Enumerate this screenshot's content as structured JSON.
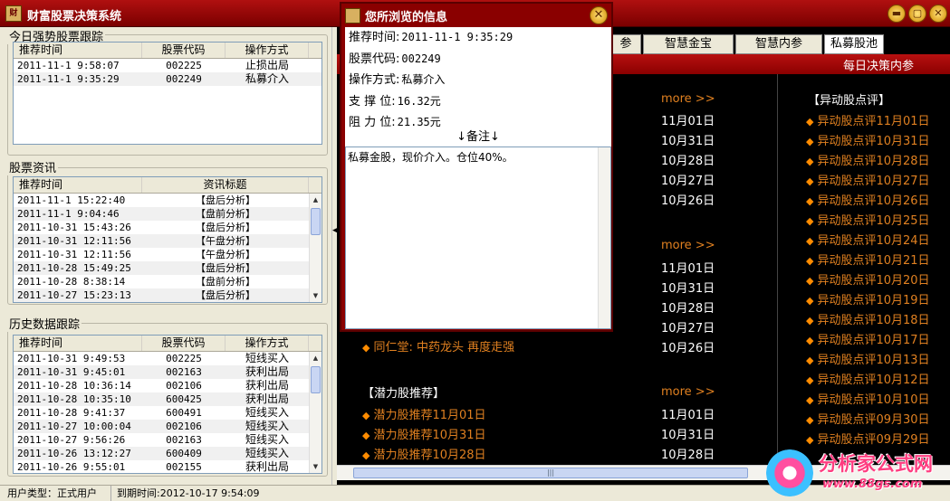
{
  "window": {
    "title": "财富股票决策系统",
    "min": "▬",
    "max": "▢",
    "close": "✕"
  },
  "strong": {
    "label": "今日强势股票跟踪",
    "headers": [
      "推荐时间",
      "股票代码",
      "操作方式"
    ],
    "rows": [
      [
        "2011-11-1 9:58:07",
        "002225",
        "止损出局"
      ],
      [
        "2011-11-1 9:35:29",
        "002249",
        "私募介入"
      ]
    ]
  },
  "news": {
    "label": "股票资讯",
    "headers": [
      "推荐时间",
      "资讯标题"
    ],
    "rows": [
      [
        "2011-11-1 15:22:40",
        "【盘后分析】"
      ],
      [
        "2011-11-1 9:04:46",
        "【盘前分析】"
      ],
      [
        "2011-10-31 15:43:26",
        "【盘后分析】"
      ],
      [
        "2011-10-31 12:11:56",
        "【午盘分析】"
      ],
      [
        "2011-10-31 12:11:56",
        "【午盘分析】"
      ],
      [
        "2011-10-28 15:49:25",
        "【盘后分析】"
      ],
      [
        "2011-10-28 8:38:14",
        "【盘前分析】"
      ],
      [
        "2011-10-27 15:23:13",
        "【盘后分析】"
      ]
    ]
  },
  "history": {
    "label": "历史数据跟踪",
    "headers": [
      "推荐时间",
      "股票代码",
      "操作方式"
    ],
    "rows": [
      [
        "2011-10-31 9:49:53",
        "002225",
        "短线买入"
      ],
      [
        "2011-10-31 9:45:01",
        "002163",
        "获利出局"
      ],
      [
        "2011-10-28 10:36:14",
        "002106",
        "获利出局"
      ],
      [
        "2011-10-28 10:35:10",
        "600425",
        "获利出局"
      ],
      [
        "2011-10-28 9:41:37",
        "600491",
        "短线买入"
      ],
      [
        "2011-10-27 10:00:04",
        "002106",
        "短线买入"
      ],
      [
        "2011-10-27 9:56:26",
        "002163",
        "短线买入"
      ],
      [
        "2011-10-26 13:12:27",
        "600409",
        "短线买入"
      ],
      [
        "2011-10-26 9:55:01",
        "002155",
        "获利出局"
      ]
    ]
  },
  "tabs": [
    "参",
    "智慧金宝",
    "智慧内参",
    "私募股池"
  ],
  "redbar": "每日决策内参",
  "content": {
    "more": "more >>",
    "bullet": "◆",
    "group1_dates": [
      "11月01日",
      "10月31日",
      "10月28日",
      "10月27日",
      "10月26日"
    ],
    "group2_dates": [
      "11月01日",
      "10月31日",
      "10月28日",
      "10月27日",
      "10月26日"
    ],
    "group2_last": "同仁堂: 中药龙头 再度走强",
    "qianli_head": "【潜力股推荐】",
    "qianli": [
      "潜力股推荐11月01日",
      "潜力股推荐10月31日",
      "潜力股推荐10月28日"
    ],
    "group3_dates": [
      "11月01日",
      "10月31日",
      "10月28日"
    ],
    "yidong_head": "【异动股点评】",
    "yidong": [
      "异动股点评11月01日",
      "异动股点评10月31日",
      "异动股点评10月28日",
      "异动股点评10月27日",
      "异动股点评10月26日",
      "异动股点评10月25日",
      "异动股点评10月24日",
      "异动股点评10月21日",
      "异动股点评10月20日",
      "异动股点评10月19日",
      "异动股点评10月18日",
      "异动股点评10月17日",
      "异动股点评10月13日",
      "异动股点评10月12日",
      "异动股点评10月10日",
      "异动股点评09月30日",
      "异动股点评09月29日"
    ]
  },
  "popup": {
    "title": "您所浏览的信息",
    "fields": [
      {
        "label": "推荐时间:",
        "value": "2011-11-1 9:35:29"
      },
      {
        "label": "股票代码:",
        "value": "002249"
      },
      {
        "label": "操作方式:",
        "value": "私募介入"
      },
      {
        "label": "支 撑 位:",
        "value": "16.32元"
      },
      {
        "label": "阻 力 位:",
        "value": "21.35元"
      }
    ],
    "note_label": "↓备注↓",
    "note_text": "私募金股，现价介入。仓位40%。"
  },
  "status": {
    "user": "用户类型：正式用户",
    "expire": "到期时间:2012-10-17 9:54:09"
  },
  "watermark": {
    "name": "分析家公式网",
    "url": "www.88gs.com"
  }
}
